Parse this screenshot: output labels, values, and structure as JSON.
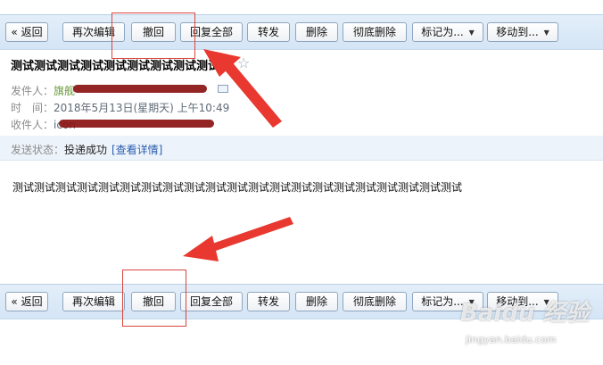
{
  "toolbar": {
    "back": "« 返回",
    "edit_again": "再次编辑",
    "recall": "撤回",
    "reply_all": "回复全部",
    "forward": "转发",
    "delete": "删除",
    "delete_permanently": "彻底删除",
    "mark_as": "标记为...",
    "move_to": "移动到..."
  },
  "mail": {
    "subject": "测试测试测试测试测试测试测试测试测试",
    "sender_label": "发件人：",
    "sender_value": "旗舰",
    "time_label": "时　间：",
    "time_value": "2018年5月13日(星期天) 上午10:49",
    "recipient_label": "收件人：",
    "recipient_value": "icon",
    "status_label": "发送状态：",
    "status_value": "投递成功",
    "status_link": "[查看详情]",
    "body": "测试测试测试测试测试测试测试测试测试测试测试测试测试测试测试测试测试测试测试测试测试"
  },
  "watermark": {
    "brand": "Baidu 经验",
    "url": "jingyan.baidu.com"
  },
  "colors": {
    "toolbar_bg": "#d4e5f6",
    "highlight": "#d9463c",
    "arrow": "#e8382f",
    "link": "#2a5db0"
  }
}
